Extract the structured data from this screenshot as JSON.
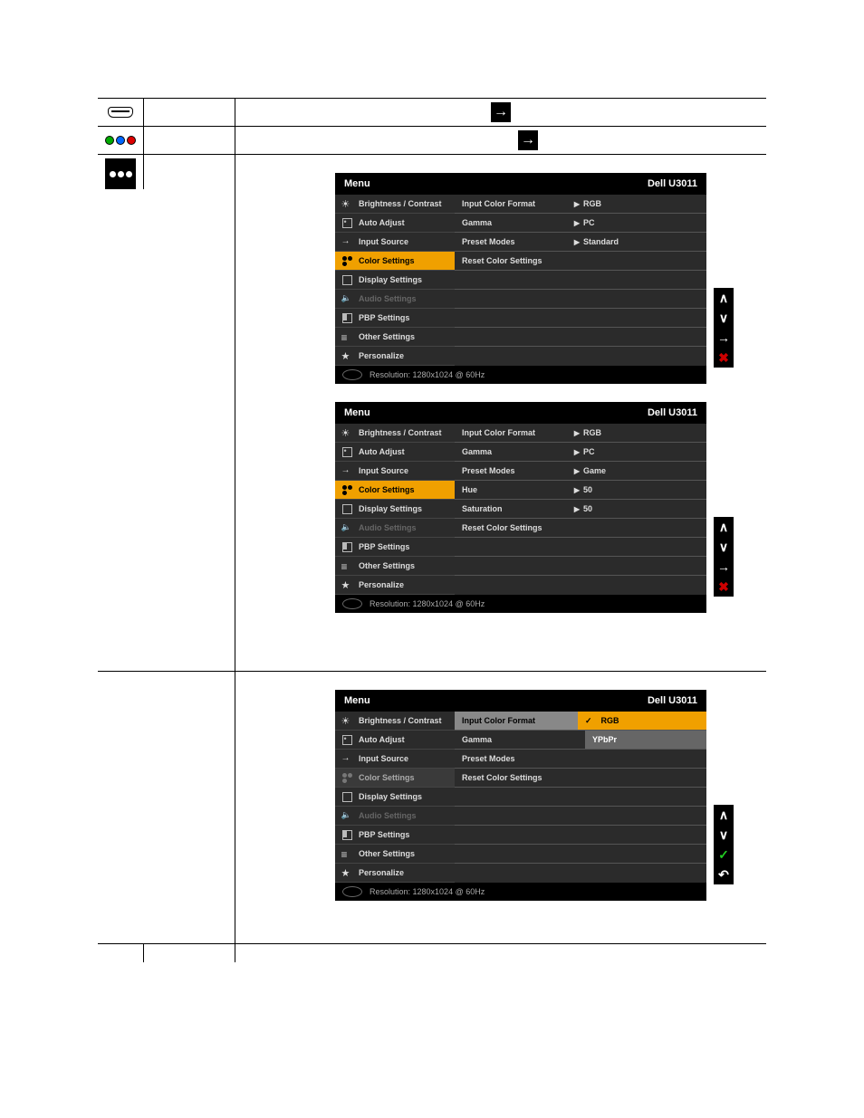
{
  "model": "Dell U3011",
  "menu_title": "Menu",
  "resolution_label": "Resolution: 1280x1024 @ 60Hz",
  "side_items": {
    "brightness": "Brightness / Contrast",
    "auto": "Auto Adjust",
    "input": "Input Source",
    "color": "Color Settings",
    "display": "Display Settings",
    "audio": "Audio Settings",
    "pbp": "PBP Settings",
    "other": "Other Settings",
    "personalize": "Personalize"
  },
  "osd1": {
    "rows": [
      {
        "label": "Input Color Format",
        "value": "RGB"
      },
      {
        "label": "Gamma",
        "value": "PC"
      },
      {
        "label": "Preset Modes",
        "value": "Standard"
      },
      {
        "label": "Reset Color Settings",
        "value": ""
      }
    ]
  },
  "osd2": {
    "rows": [
      {
        "label": "Input Color Format",
        "value": "RGB"
      },
      {
        "label": "Gamma",
        "value": "PC"
      },
      {
        "label": "Preset Modes",
        "value": "Game"
      },
      {
        "label": "Hue",
        "value": "50"
      },
      {
        "label": "Saturation",
        "value": "50"
      },
      {
        "label": "Reset Color Settings",
        "value": ""
      }
    ]
  },
  "osd3": {
    "row0_label": "Input Color Format",
    "row0_sel": "RGB",
    "row1_label": "Gamma",
    "row1_val": "YPbPr",
    "row2_label": "Preset Modes",
    "row3_label": "Reset Color Settings"
  }
}
